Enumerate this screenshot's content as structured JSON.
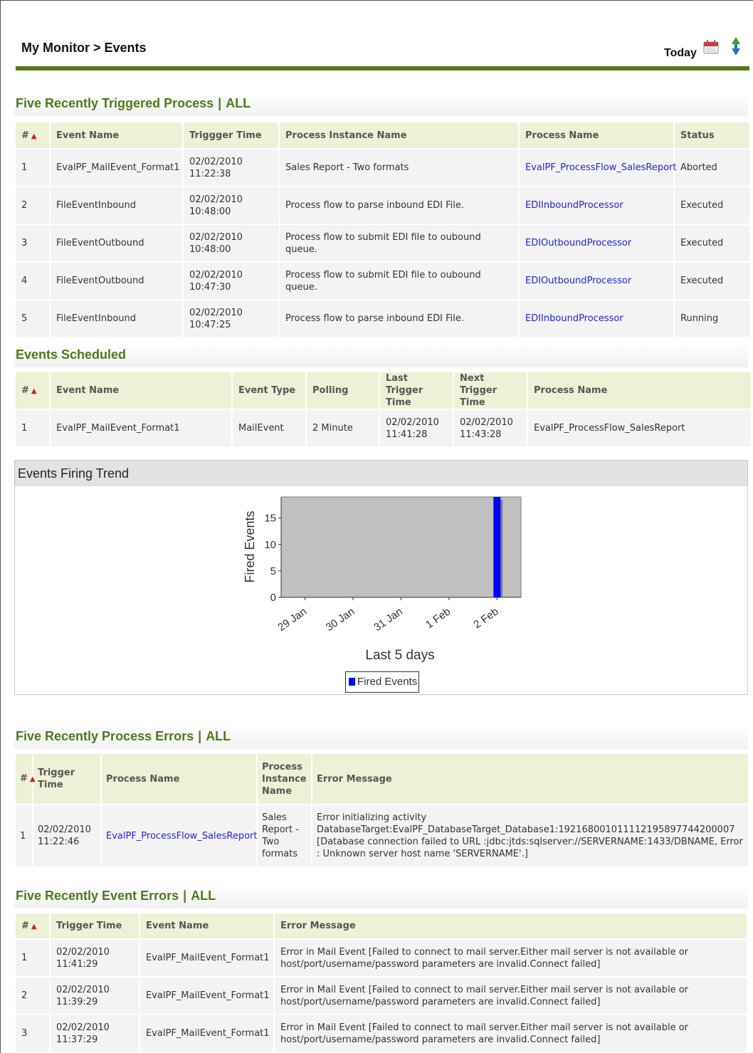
{
  "header": {
    "breadcrumb": "My Monitor > Events",
    "today_label": "Today",
    "calendar_icon": "calendar-icon",
    "refresh_icon": "refresh-icon"
  },
  "triggered": {
    "title": "Five Recently Triggered Process",
    "all_link": "ALL",
    "columns": [
      "#",
      "Event Name",
      "Triggger Time",
      "Process Instance Name",
      "Process Name",
      "Status"
    ],
    "rows": [
      {
        "num": "1",
        "event": "EvalPF_MailEvent_Format1",
        "time": "02/02/2010\n11:22:38",
        "instance": "Sales Report - Two formats",
        "process": "EvalPF_ProcessFlow_SalesReport",
        "status": "Aborted"
      },
      {
        "num": "2",
        "event": "FileEventInbound",
        "time": "02/02/2010\n10:48:00",
        "instance": "Process flow to parse inbound EDI File.",
        "process": "EDIInboundProcessor",
        "status": "Executed"
      },
      {
        "num": "3",
        "event": "FileEventOutbound",
        "time": "02/02/2010\n10:48:00",
        "instance": "Process flow to submit EDI file to oubound queue.",
        "process": "EDIOutboundProcessor",
        "status": "Executed"
      },
      {
        "num": "4",
        "event": "FileEventOutbound",
        "time": "02/02/2010\n10:47:30",
        "instance": "Process flow to submit EDI file to oubound queue.",
        "process": "EDIOutboundProcessor",
        "status": "Executed"
      },
      {
        "num": "5",
        "event": "FileEventInbound",
        "time": "02/02/2010\n10:47:25",
        "instance": "Process flow to parse inbound EDI File.",
        "process": "EDIInboundProcessor",
        "status": "Running"
      }
    ]
  },
  "scheduled": {
    "title": "Events Scheduled",
    "columns": [
      "#",
      "Event Name",
      "Event Type",
      "Polling",
      "Last Trigger Time",
      "Next Trigger Time",
      "Process Name"
    ],
    "rows": [
      {
        "num": "1",
        "event": "EvalPF_MailEvent_Format1",
        "type": "MailEvent",
        "polling": "2 Minute",
        "last": "02/02/2010\n11:41:28",
        "next": "02/02/2010\n11:43:28",
        "process": "EvalPF_ProcessFlow_SalesReport"
      }
    ]
  },
  "trend": {
    "title": "Events Firing Trend",
    "legend_label": "Fired Events"
  },
  "chart_data": {
    "type": "bar",
    "categories": [
      "29 Jan",
      "30 Jan",
      "31 Jan",
      "1 Feb",
      "2 Feb"
    ],
    "series": [
      {
        "name": "Fired Events",
        "values": [
          0,
          0,
          0,
          0,
          19
        ],
        "color": "#0000ff"
      }
    ],
    "xlabel": "Last 5 days",
    "ylabel": "Fired Events",
    "ylim": [
      0,
      19
    ],
    "yticks": [
      0,
      5,
      10,
      15
    ],
    "grid": false,
    "legend": "bottom"
  },
  "process_errors": {
    "title": "Five Recently Process Errors",
    "all_link": "ALL",
    "columns": [
      "#",
      "Trigger Time",
      "Process Name",
      "Process Instance Name",
      "Error Message"
    ],
    "rows": [
      {
        "num": "1",
        "time": "02/02/2010\n11:22:46",
        "process": "EvalPF_ProcessFlow_SalesReport",
        "instance": "Sales Report - Two formats",
        "message": "Error initializing activity DatabaseTarget:EvalPF_DatabaseTarget_Database1:19216800101111219589774420000​7 [Database connection failed to URL :jdbc:jtds:sqlserver://SERVERNAME:1433/DBNAME, Error : Unknown server host name 'SERVERNAME'.]"
      }
    ]
  },
  "event_errors": {
    "title": "Five Recently Event Errors",
    "all_link": "ALL",
    "columns": [
      "#",
      "Trigger Time",
      "Event Name",
      "Error Message"
    ],
    "rows": [
      {
        "num": "1",
        "time": "02/02/2010\n11:41:29",
        "event": "EvalPF_MailEvent_Format1",
        "message": "Error in Mail Event [Failed to connect to mail server.Either mail server is not available or host/port/username/password parameters are invalid.Connect failed]"
      },
      {
        "num": "2",
        "time": "02/02/2010\n11:39:29",
        "event": "EvalPF_MailEvent_Format1",
        "message": "Error in Mail Event [Failed to connect to mail server.Either mail server is not available or host/port/username/password parameters are invalid.Connect failed]"
      },
      {
        "num": "3",
        "time": "02/02/2010\n11:37:29",
        "event": "EvalPF_MailEvent_Format1",
        "message": "Error in Mail Event [Failed to connect to mail server.Either mail server is not available or host/port/username/password parameters are invalid.Connect failed]"
      }
    ]
  }
}
